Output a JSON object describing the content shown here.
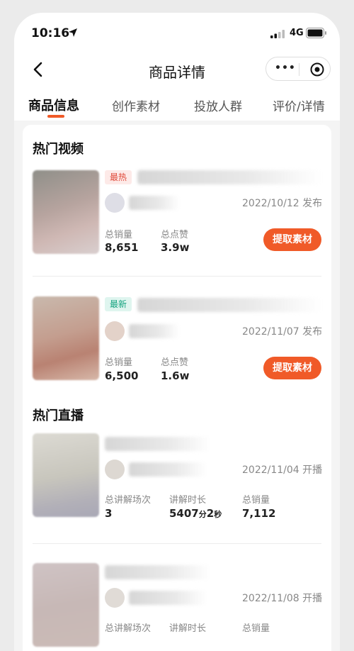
{
  "status_bar": {
    "time": "10:16",
    "network": "4G"
  },
  "nav": {
    "title": "商品详情",
    "more_label": "•••"
  },
  "tabs": [
    {
      "label": "商品信息"
    },
    {
      "label": "创作素材"
    },
    {
      "label": "投放人群"
    },
    {
      "label": "评价/详情"
    }
  ],
  "hot_videos": {
    "title": "热门视频",
    "items": [
      {
        "badge": "最热",
        "date": "2022/10/12 发布",
        "stats": [
          {
            "label": "总销量",
            "value": "8,651"
          },
          {
            "label": "总点赞",
            "value": "3.9w"
          }
        ],
        "button": "提取素材"
      },
      {
        "badge": "最新",
        "date": "2022/11/07 发布",
        "stats": [
          {
            "label": "总销量",
            "value": "6,500"
          },
          {
            "label": "总点赞",
            "value": "1.6w"
          }
        ],
        "button": "提取素材"
      }
    ]
  },
  "hot_live": {
    "title": "热门直播",
    "items": [
      {
        "date": "2022/11/04 开播",
        "stats": [
          {
            "label": "总讲解场次",
            "value": "3"
          },
          {
            "label": "讲解时长",
            "value_min": "5407",
            "unit_min": "分",
            "value_sec": "2",
            "unit_sec": "秒"
          },
          {
            "label": "总销量",
            "value": "7,112"
          }
        ]
      },
      {
        "date": "2022/11/08 开播",
        "stats": [
          {
            "label": "总讲解场次"
          },
          {
            "label": "讲解时长"
          },
          {
            "label": "总销量"
          }
        ]
      }
    ]
  },
  "colors": {
    "accent": "#f05a28",
    "hot_badge": "#e04a3a",
    "new_badge": "#14a37f"
  }
}
